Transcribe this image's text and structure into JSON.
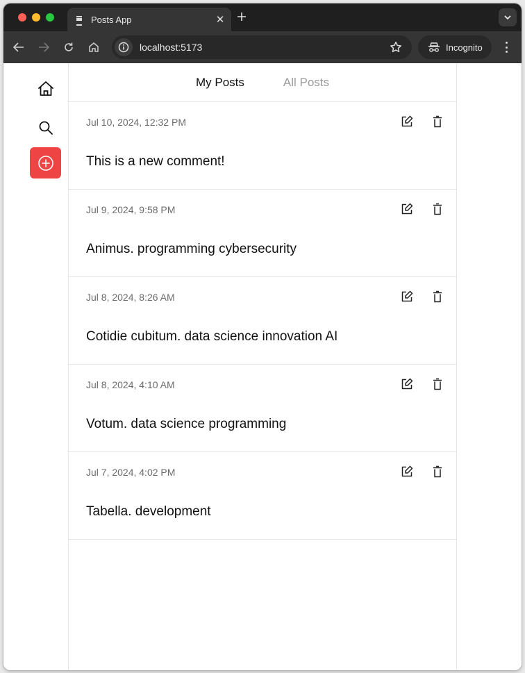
{
  "browser": {
    "tab_title": "Posts App",
    "url": "localhost:5173",
    "incognito_label": "Incognito",
    "icons": {
      "back": "arrow-left-icon",
      "forward": "arrow-right-icon",
      "reload": "reload-icon",
      "home": "home-icon",
      "site_info": "info-icon",
      "bookmark": "star-icon",
      "incognito": "incognito-icon",
      "menu": "kebab-icon",
      "tab_close": "close-icon",
      "new_tab": "plus-icon",
      "tab_search": "chevron-down-icon"
    }
  },
  "sidebar": {
    "items": [
      {
        "name": "home",
        "icon": "home-icon"
      },
      {
        "name": "search",
        "icon": "search-icon"
      },
      {
        "name": "create-post",
        "icon": "plus-circle-icon",
        "accent": "#ef4444"
      }
    ]
  },
  "tabs": {
    "my_posts": "My Posts",
    "all_posts": "All Posts",
    "active": "My Posts"
  },
  "posts": [
    {
      "date": "Jul 10, 2024, 12:32 PM",
      "body": "This is a new comment!"
    },
    {
      "date": "Jul 9, 2024, 9:58 PM",
      "body": "Animus. programming cybersecurity"
    },
    {
      "date": "Jul 8, 2024, 8:26 AM",
      "body": "Cotidie cubitum. data science innovation AI"
    },
    {
      "date": "Jul 8, 2024, 4:10 AM",
      "body": "Votum. data science programming"
    },
    {
      "date": "Jul 7, 2024, 4:02 PM",
      "body": "Tabella. development"
    }
  ],
  "colors": {
    "accent": "#ef4444",
    "text_primary": "#111111",
    "text_muted": "#6b6b6b",
    "tab_inactive": "#9a9a9a",
    "border": "#e5e5e5"
  }
}
